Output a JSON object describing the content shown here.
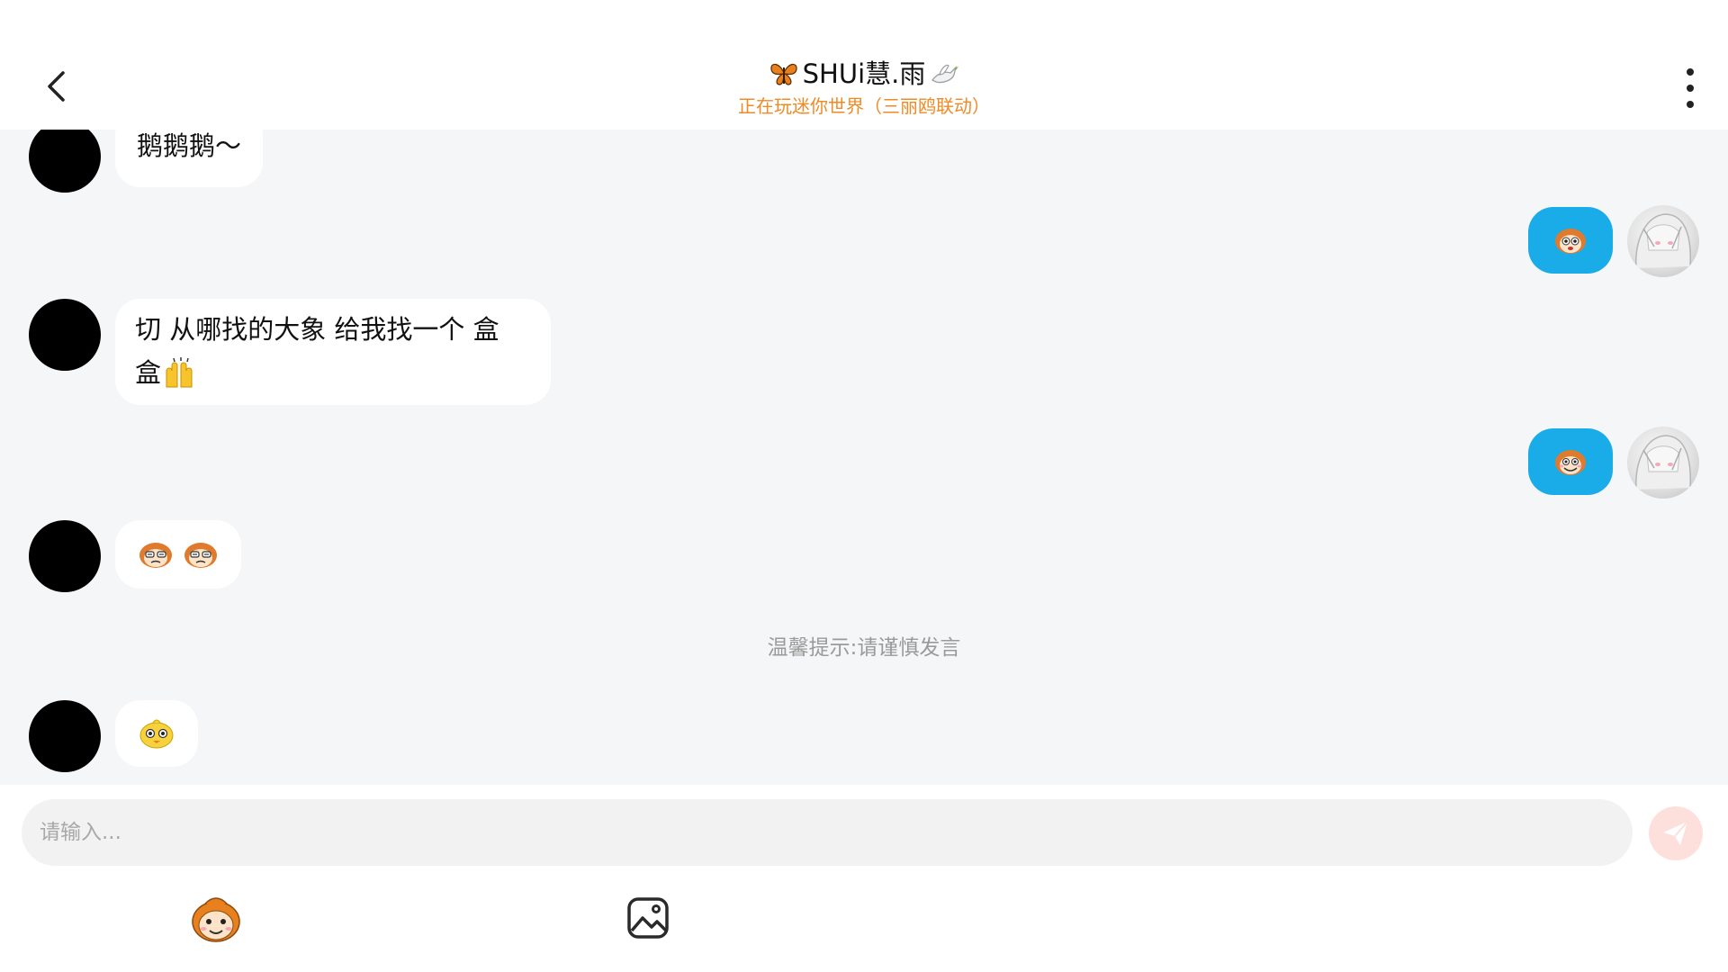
{
  "header": {
    "title_text": "SHUi慧.雨",
    "subtitle": "正在玩迷你世界（三丽鸥联动）",
    "back_icon": "chevron-left-icon",
    "more_icon": "vertical-dots-icon"
  },
  "messages": [
    {
      "side": "left",
      "text": "鹅鹅鹅～"
    },
    {
      "side": "right",
      "sticker": "monkey-sticker-icon"
    },
    {
      "side": "left",
      "text_line1": "切 从哪找的大象 给我找一个 盒",
      "text_line2": "盒",
      "emoji": "raised-hands-icon"
    },
    {
      "side": "right",
      "sticker": "monkey-grin-sticker-icon"
    },
    {
      "side": "left",
      "stickers": [
        "monkey-squint-sticker-icon",
        "monkey-squint-sticker-icon"
      ]
    },
    {
      "side": "left",
      "sticker": "yellow-chick-sticker-icon"
    }
  ],
  "tip": "温馨提示:请谨慎发言",
  "input": {
    "placeholder": "请输入..."
  },
  "colors": {
    "accent_orange": "#f08a24",
    "bubble_blue": "#1aace8",
    "chat_bg": "#f5f6f8",
    "send_disabled": "#fde0dc"
  }
}
